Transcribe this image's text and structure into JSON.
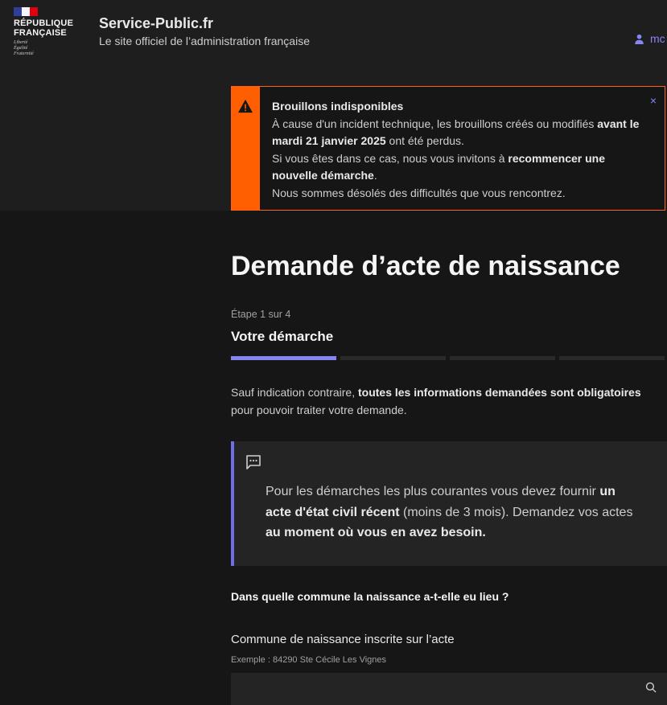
{
  "header": {
    "logo": {
      "title_line1": "RÉPUBLIQUE",
      "title_line2": "FRANÇAISE",
      "motto_line1": "Liberté",
      "motto_line2": "Égalité",
      "motto_line3": "Fraternité"
    },
    "site_name": "Service-Public.fr",
    "tagline": "Le site officiel de l’administration française",
    "user_label": "mc"
  },
  "alert": {
    "title": "Brouillons indisponibles",
    "line1_start": "À cause d'un incident technique, les brouillons créés ou modifiés ",
    "line1_bold": "avant le mardi 21 janvier 2025",
    "line1_end": " ont été perdus.",
    "line2_start": "Si vous êtes dans ce cas, nous vous invitons à ",
    "line2_bold": "recommencer une nouvelle démarche",
    "line2_end": ".",
    "line3": "Nous sommes désolés des difficultés que vous rencontrez.",
    "close_symbol": "×",
    "colors": {
      "accent": "#ff5f00"
    }
  },
  "main": {
    "title": "Demande d’acte de naissance",
    "step_label": "Étape 1 sur 4",
    "step_title": "Votre démarche",
    "stepper": {
      "total": 4,
      "current": 1
    },
    "intro_start": "Sauf indication contraire, ",
    "intro_bold": "toutes les informations demandées sont obligatoires",
    "intro_end": " pour pouvoir traiter votre demande.",
    "callout": {
      "text_start": "Pour les démarches les plus courantes vous devez fournir ",
      "bold1": "un acte d'état civil récent",
      "text_mid": " (moins de 3 mois). Demandez vos actes ",
      "bold2": "au moment où vous en avez besoin.",
      "icon": "chat-message-icon"
    },
    "question": "Dans quelle commune la naissance a-t-elle eu lieu ?",
    "field": {
      "label": "Commune de naissance inscrite sur l’acte",
      "hint": "Exemple : 84290 Ste Cécile Les Vignes",
      "value": "",
      "icon": "search-icon"
    }
  },
  "colors": {
    "primary": "#8585f6",
    "background": "#161616",
    "surface": "#1e1e1e"
  }
}
